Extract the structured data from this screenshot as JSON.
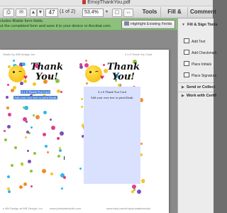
{
  "window": {
    "title": "EmojiThankYou.pdf"
  },
  "toolbar": {
    "page_current": "47",
    "page_of": "(1 of 2)",
    "zoom": "53.4%",
    "tabs": [
      "Tools",
      "Fill & Sign",
      "Comment"
    ]
  },
  "notice": {
    "line1": "cludes fillable form fields.",
    "line2": "ut the completed form and save it to your device or Acrobat.com.",
    "button": "Highlight Existing Fields"
  },
  "page": {
    "header_left": "Studio by WB Design, Inc",
    "header_right": "4 x 6 Thank You Card",
    "footer_left": "e 8th Design at WB Design, Inc",
    "footer_mid": "www.printablestudio.com",
    "footer_right": "www.etsy.com/shop/printablestudio"
  },
  "cards": [
    {
      "thanks": "Thank You!",
      "line1": "4 x 6 Thank You Card",
      "line2": "Add your own text or print blank."
    },
    {
      "thanks": "Thank You!",
      "line1": "4 x 6 Thank You Card",
      "line2": "Add your own text or print blank."
    }
  ],
  "panel": {
    "section": "Fill & Sign Tools",
    "items": [
      "Add Text",
      "Add Checkmark",
      "Place Initials",
      "Place Signature"
    ],
    "sections": [
      "Send or Collect",
      "Work with Certif"
    ]
  },
  "colors": {
    "notice_bg": "#8bc17a",
    "field_bg": "#d9e1ff",
    "selection": "#4a82d6",
    "confetti": [
      "#f3c623",
      "#2fb7e8",
      "#e63b8a",
      "#8ac43f",
      "#7a4fb5",
      "#f28c28"
    ]
  }
}
